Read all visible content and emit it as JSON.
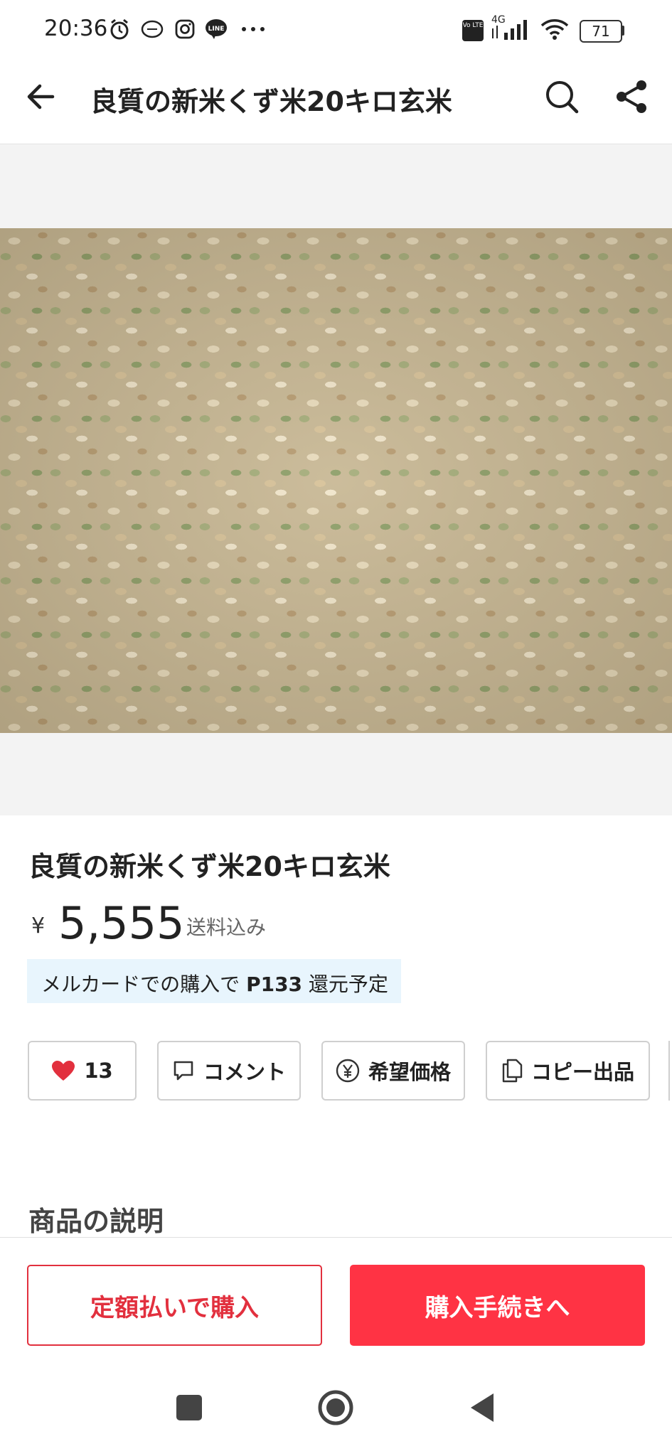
{
  "status_bar": {
    "time": "20:36",
    "icons": [
      "alarm-icon",
      "link-icon",
      "instagram-icon",
      "line-icon",
      "more-dots-icon",
      "volte-icon",
      "signal-4g-icon",
      "wifi-icon"
    ],
    "network_label": "4G",
    "volte_label": "Vo LTE",
    "battery": "71"
  },
  "app_bar": {
    "title": "良質の新米くず米20キロ玄米"
  },
  "product": {
    "name": "良質の新米くず米20キロ玄米",
    "currency": "¥",
    "price": "5,555",
    "shipping_note": "送料込み",
    "points_prefix": "メルカードでの購入で ",
    "points_value": "P133",
    "points_suffix": " 還元予定"
  },
  "actions": {
    "like_count": "13",
    "comment_label": "コメント",
    "offer_label": "希望価格",
    "copy_label": "コピー出品"
  },
  "section_title": "商品の説明",
  "purchase": {
    "installment_label": "定額払いで購入",
    "buy_label": "購入手続きへ"
  },
  "colors": {
    "accent": "#ff3344",
    "accent_outline": "#e2303e",
    "points_banner_bg": "#e8f5fd",
    "heart": "#e2303e"
  }
}
